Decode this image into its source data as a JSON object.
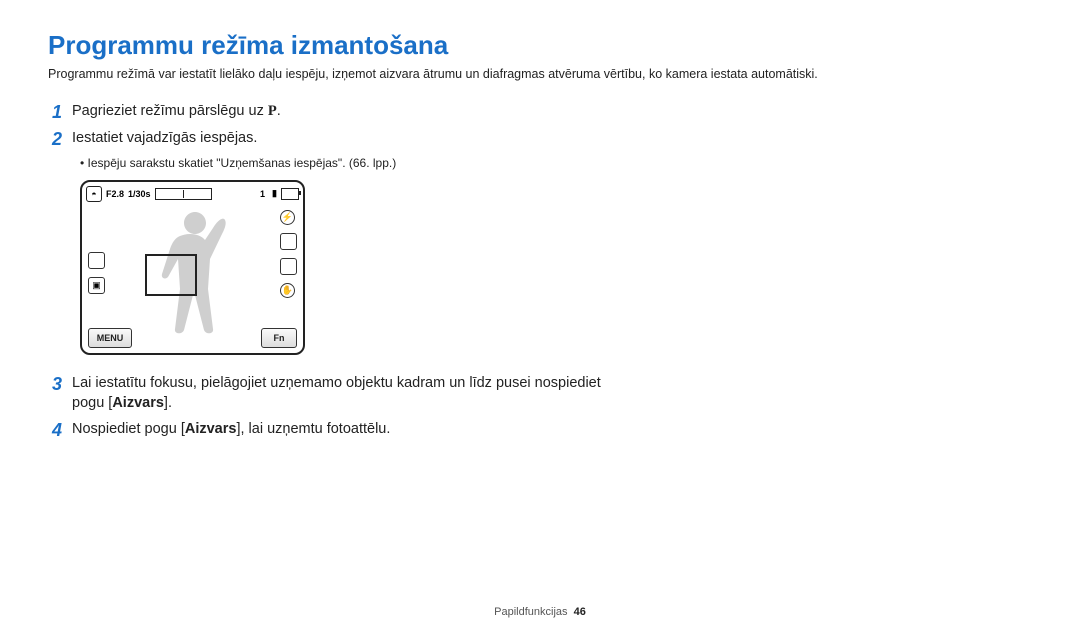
{
  "title": "Programmu režīma izmantošana",
  "subtitle": "Programmu režīmā var iestatīt lielāko daļu iespēju, izņemot aizvara ātrumu un diafragmas atvēruma vērtību, ko kamera iestata automātiski.",
  "steps": {
    "s1": {
      "text_a": "Pagrieziet režīmu pārslēgu uz ",
      "mode": "P",
      "text_b": "."
    },
    "s2": {
      "text": "Iestatiet vajadzīgās iespējas.",
      "bullet": "Iespēju sarakstu skatiet \"Uzņemšanas iespējas\". (66. lpp.)"
    },
    "s3": {
      "text_a": "Lai iestatītu fokusu, pielāgojiet uzņemamo objektu kadram un līdz pusei nospiediet pogu [",
      "bold": "Aizvars",
      "text_b": "]."
    },
    "s4": {
      "text_a": "Nospiediet pogu [",
      "bold": "Aizvars",
      "text_b": "], lai uzņemtu fotoattēlu."
    }
  },
  "camera": {
    "aperture": "F2.8",
    "shutter": "1/30s",
    "count": "1",
    "menu": "MENU",
    "fn": "Fn"
  },
  "footer": {
    "section": "Papildfunkcijas",
    "page": "46"
  }
}
